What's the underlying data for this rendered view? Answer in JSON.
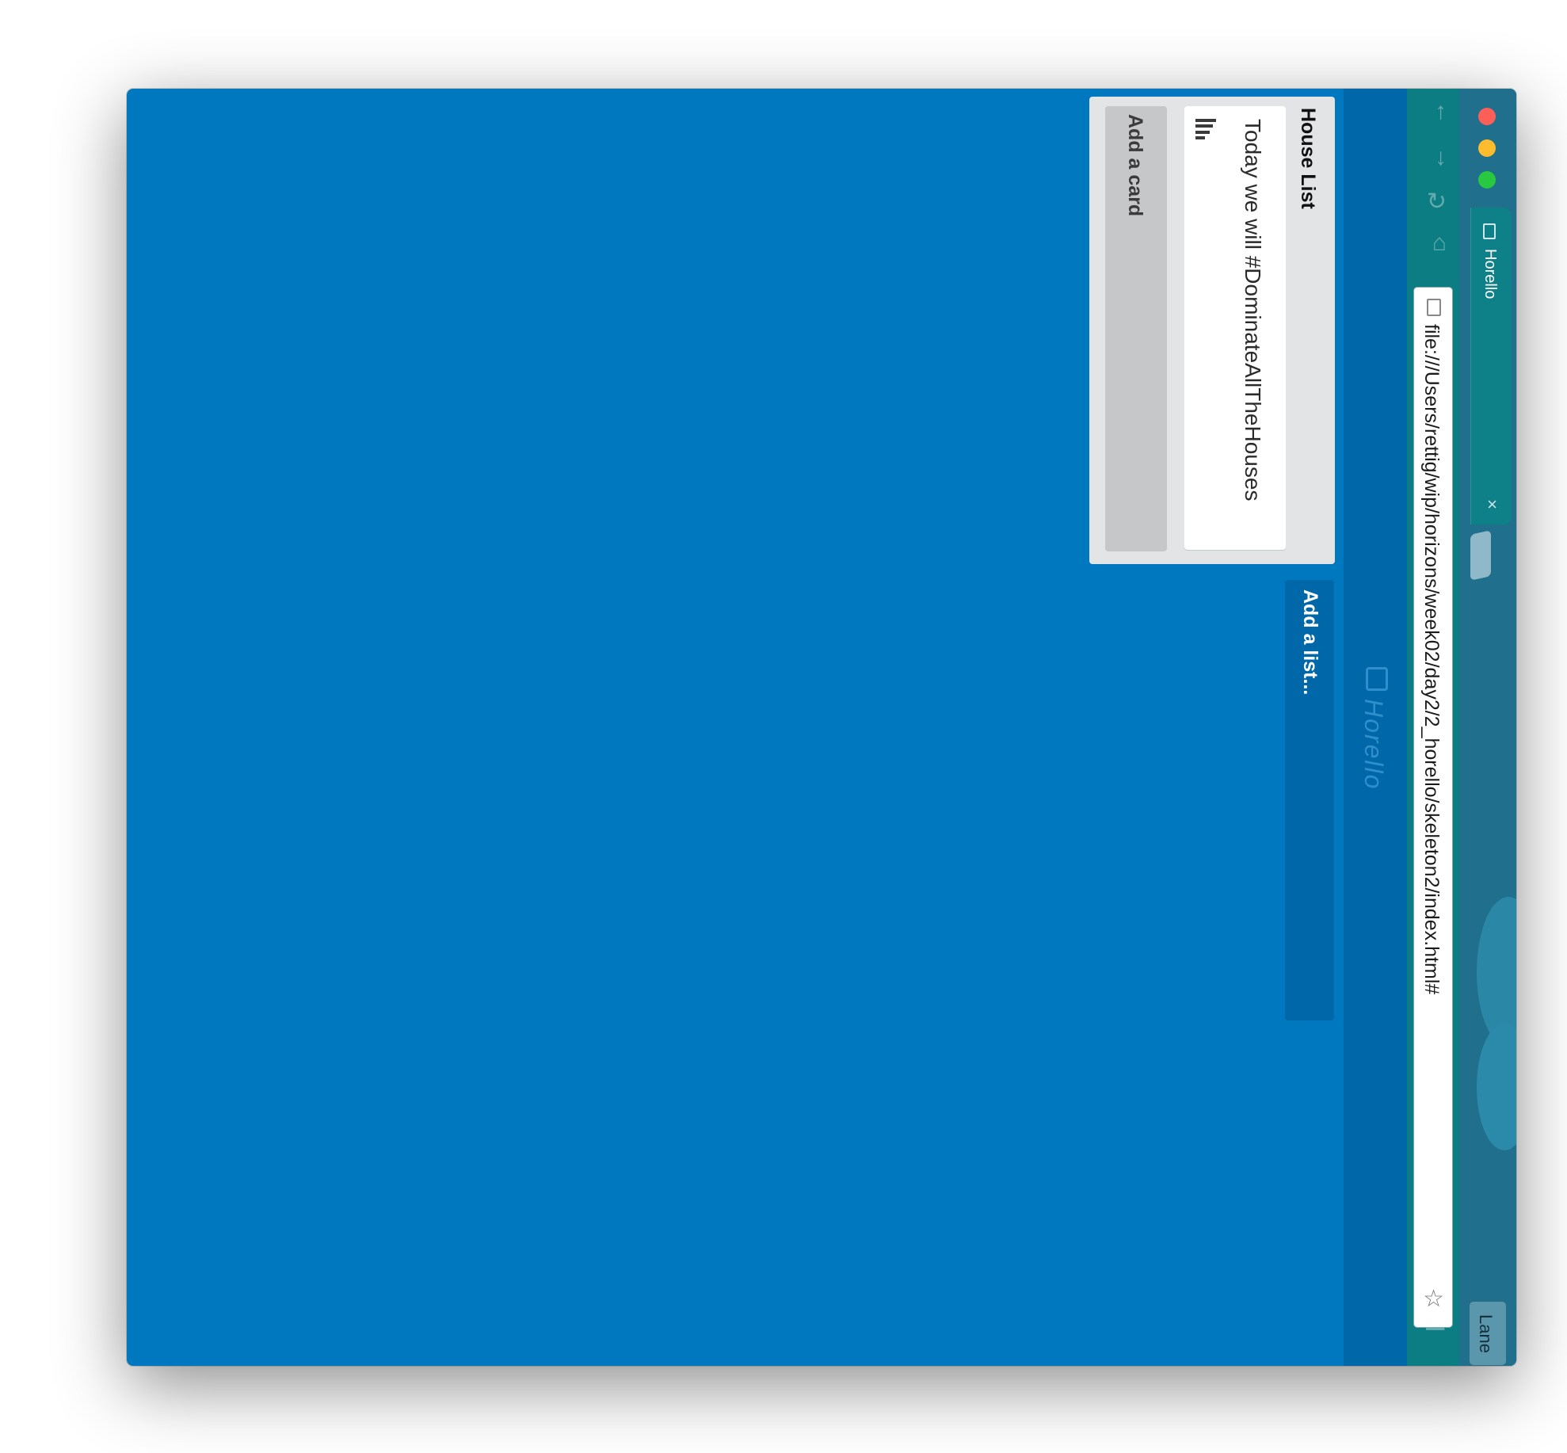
{
  "browser": {
    "tab_title": "Horello",
    "url": "file:///Users/rettig/wip/horizons/week02/day2/2_horello/skeleton2/index.html#",
    "profile_label": "Lane",
    "icons": {
      "back": "arrow-up-icon",
      "forward": "arrow-down-icon",
      "reload": "reload-icon",
      "home": "home-icon",
      "bookmark": "star-icon",
      "menu": "hamburger-menu-icon"
    }
  },
  "board": {
    "logo_text": "Horello",
    "background_color": "#0078bf",
    "lists": [
      {
        "title": "House List",
        "cards": [
          {
            "text": "Today we will #DominateAllTheHouses",
            "has_description": true
          }
        ],
        "add_card_label": "Add a card"
      }
    ],
    "add_list_label": "Add a list..."
  }
}
